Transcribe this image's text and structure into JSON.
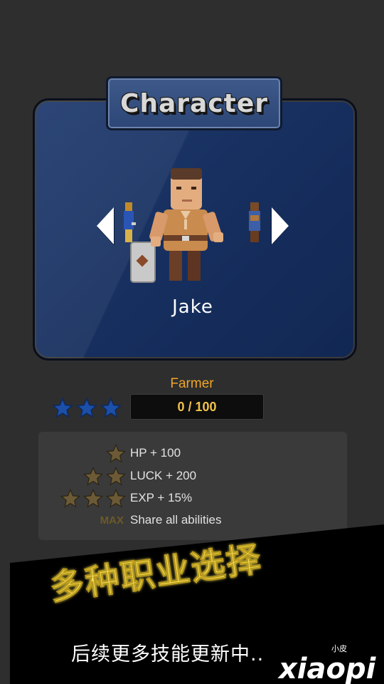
{
  "screen": {
    "title": "Character",
    "character_name": "Jake",
    "job_title": "Farmer",
    "rank_stars": 3,
    "progress": {
      "text": "0 / 100",
      "current": 0,
      "max": 100
    },
    "nav": {
      "prev_icon": "chevron-left-icon",
      "next_icon": "chevron-right-icon"
    }
  },
  "abilities": [
    {
      "level_stars": 1,
      "label": "HP + 100"
    },
    {
      "level_stars": 2,
      "label": "LUCK + 200"
    },
    {
      "level_stars": 3,
      "label": "EXP + 15%"
    },
    {
      "max_tag": "MAX",
      "label": "Share all abilities"
    }
  ],
  "promo": {
    "headline": "多种职业选择",
    "subline": "后续更多技能更新中..",
    "logo_small": "小皮",
    "logo_text": "xiaopi"
  },
  "colors": {
    "card_blue": "#1a3566",
    "star_blue": "#1c4fa8",
    "star_gold_dim": "#6b5a35",
    "job_gold": "#f0a527",
    "headline_yellow": "#f5e15a"
  }
}
